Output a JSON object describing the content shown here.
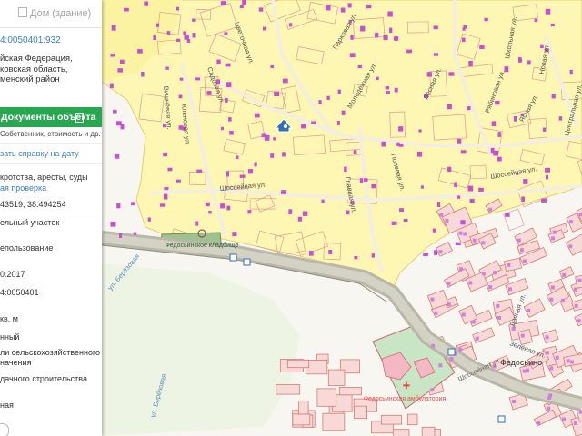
{
  "header": {
    "building_tab_label": "Дом (здание)"
  },
  "parcel": {
    "cadastral_number": "4:0050401:932",
    "address_lines": [
      "йская Федерация,",
      "ковская область,",
      "менский район"
    ],
    "documents_button_label": "Документы объекта",
    "documents_subtitle": "Собственник, стоимость и др.",
    "certificate_link": "зать справку на дату",
    "encumbrances_text": "кротства, аресты, суды",
    "check_link": "ая проверка",
    "coordinates": "43519, 38.494254"
  },
  "fields": [
    "ельный участок",
    "епользование",
    "0.2017",
    "4:0050401",
    "кв. м",
    "нный",
    "ли сельскохозяйственного",
    "начения",
    "дачного строительства",
    "ная"
  ],
  "map_labels": {
    "streets": [
      "Шоссейная ул.",
      "Шоссейная ул.",
      "Шоссейная ул.",
      "Садовая ул.",
      "Главная ул.",
      "Цветочная ул.",
      "Парковая ул.",
      "Молодёжная ул.",
      "Лесная ул.",
      "Зелёная ул.",
      "Полевая ул.",
      "Вишнёвая ул.",
      "Новая ул.",
      "Рябиновая ул.",
      "Кленовая ул.",
      "Школьная ул.",
      "Дачная ул.",
      "Ясная ул.",
      "Центральная ул.",
      "ул. Берёзовая",
      "ул. Берёзовая"
    ],
    "village": "Федосьино",
    "clinic": "Федосьинская амбулатория",
    "cemetery": "Федосьинское кладбище"
  },
  "colors": {
    "accent_green": "#27a750",
    "link_blue": "#3a7fc1",
    "parcel_fill": "#fdf7b3",
    "parcel_line": "#e29a95",
    "building_purple": "#c64fd3",
    "road_gray": "#b8b8a8"
  }
}
